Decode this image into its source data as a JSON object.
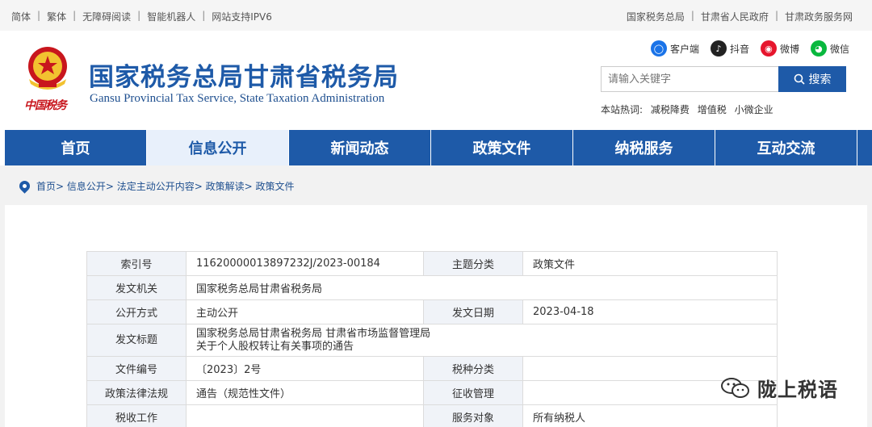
{
  "topbar": {
    "left_links": [
      "简体",
      "繁体",
      "无障碍阅读",
      "智能机器人",
      "网站支持IPV6"
    ],
    "right_links": [
      "国家税务总局",
      "甘肃省人民政府",
      "甘肃政务服务网"
    ]
  },
  "header": {
    "brush_text": "中国税务",
    "title": "国家税务总局甘肃省税务局",
    "subtitle": "Gansu Provincial Tax Service, State Taxation Administration"
  },
  "social": [
    {
      "label": "客户端",
      "icon": "app-icon",
      "glyph": "◯"
    },
    {
      "label": "抖音",
      "icon": "douyin-icon",
      "glyph": "♪"
    },
    {
      "label": "微博",
      "icon": "weibo-icon",
      "glyph": "◉"
    },
    {
      "label": "微信",
      "icon": "wechat-icon",
      "glyph": "◕"
    }
  ],
  "search": {
    "placeholder": "请输入关键字",
    "button": "搜索"
  },
  "hot": {
    "label": "本站热词:",
    "words": [
      "减税降费",
      "增值税",
      "小微企业"
    ]
  },
  "nav": [
    "首页",
    "信息公开",
    "新闻动态",
    "政策文件",
    "纳税服务",
    "互动交流"
  ],
  "breadcrumb": "首页> 信息公开> 法定主动公开内容> 政策解读> 政策文件",
  "table": {
    "r1": {
      "l1": "索引号",
      "v1": "11620000013897232J/2023-00184",
      "l2": "主题分类",
      "v2": "政策文件"
    },
    "r2": {
      "l1": "发文机关",
      "v1": "国家税务总局甘肃省税务局"
    },
    "r3": {
      "l1": "公开方式",
      "v1": "主动公开",
      "l2": "发文日期",
      "v2": "2023-04-18"
    },
    "r4": {
      "l1": "发文标题",
      "v1a": "国家税务总局甘肃省税务局 甘肃省市场监督管理局",
      "v1b": "关于个人股权转让有关事项的通告"
    },
    "r5": {
      "l1": "文件编号",
      "v1": "〔2023〕2号",
      "l2": "税种分类",
      "v2": ""
    },
    "r6": {
      "l1": "政策法律法规",
      "v1": "通告（规范性文件）",
      "l2": "征收管理",
      "v2": ""
    },
    "r7": {
      "l1": "税收工作",
      "v1": "",
      "l2": "服务对象",
      "v2": "所有纳税人"
    }
  },
  "watermark": "陇上税语",
  "colors": {
    "brand_blue": "#1e5aa8",
    "nav_active_bg": "#e8f0fb",
    "brush_red": "#c8161d"
  }
}
